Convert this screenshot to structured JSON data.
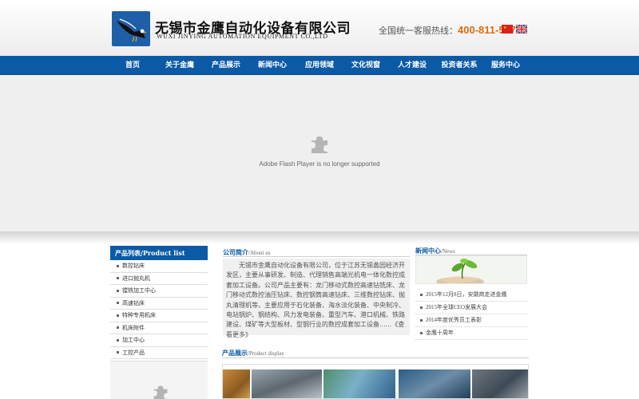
{
  "header": {
    "company_cn": "无锡市金鹰自动化设备有限公司",
    "company_en": "WUXI JINYING AUTOMATION EQUIPMENT CO.,LTD",
    "hotline_label": "全国统一客服热线：",
    "hotline_number": "400-811-5677",
    "flags": [
      "cn-flag-icon",
      "uk-flag-icon"
    ]
  },
  "nav": {
    "items": [
      "首页",
      "关于金鹰",
      "产品展示",
      "新闻中心",
      "应用领域",
      "文化视窗",
      "人才建设",
      "投资者关系",
      "服务中心"
    ]
  },
  "banner": {
    "message": "Adobe Flash Player is no longer supported",
    "icon": "puzzle-piece-icon"
  },
  "product_list": {
    "title": "产品列表/Product list",
    "items": [
      "数控钻床",
      "进口抛丸机",
      "镗铣加工中心",
      "高速钻床",
      "特种专用机床",
      "机床附件",
      "加工中心",
      "工控产品"
    ]
  },
  "about": {
    "title_cn": "公司简介",
    "title_en": "/About us",
    "text": "无锡市金鹰自动化设备有限公司，位于江苏无锡蠡园经济开发区，主要从事研发、制造、代理销售高端光机电一体化数控成套加工设备。公司产品主要有：龙门移动式数控高速钻铣床、龙门移动式数控油压钻床、数控钢筒高速钻床、三维数控钻床、抛丸清理机等。主要应用于石化装备、海水淡化装备、中央制冷、电站锅炉、钢结构、风力发电装备、重型汽车、港口机械、铁路建设、煤矿等大型板材、型钢行业的数控成套加工设备......《查看更多》"
  },
  "news": {
    "title_cn": "新闻中心",
    "title_en": "/News",
    "items": [
      "2015年12月8日，安徽商走进金鹰",
      "2015年全球CEO发展大会",
      "2014年度优秀员工表彰",
      "金鹰十周年"
    ]
  },
  "products": {
    "title_cn": "产品展示",
    "title_en": "/Product display"
  },
  "colors": {
    "brand_blue": "#0b5aa6",
    "hotline_orange": "#e06a10",
    "banner_bg": "#efefef"
  }
}
